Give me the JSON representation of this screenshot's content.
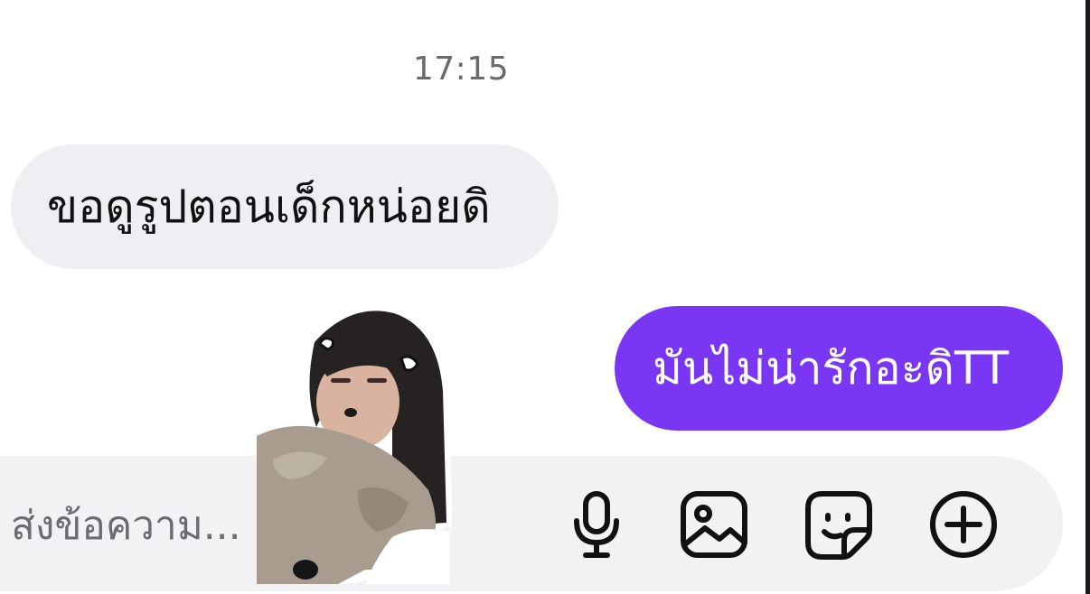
{
  "chat": {
    "timestamp": "17:15",
    "messages": [
      {
        "direction": "received",
        "text": "ขอดูรูปตอนเด็กหน่อยดิ"
      },
      {
        "direction": "sent",
        "text": "มันไม่น่ารักอะดิTT"
      }
    ],
    "sticker": {
      "kind": "photo-cutout-sticker",
      "icon": "face-sticker-image"
    }
  },
  "composer": {
    "placeholder": "ส่งข้อความ...",
    "value": "",
    "icons": [
      "microphone-icon",
      "image-icon",
      "sticker-icon",
      "plus-circle-icon"
    ]
  },
  "colors": {
    "sent_bubble": "#7a37f3",
    "received_bubble": "#efeff3",
    "composer_bg": "#f2f2f5",
    "timestamp_text": "#6a6a6e"
  }
}
